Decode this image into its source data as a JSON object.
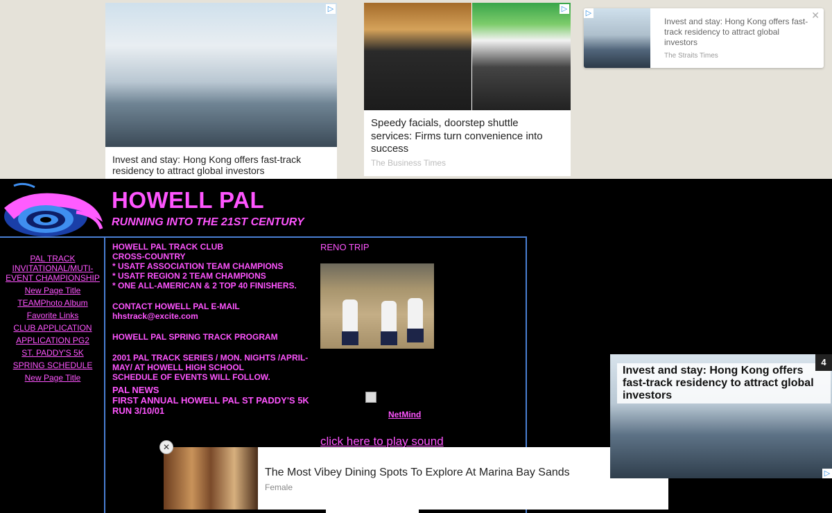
{
  "top_ads": {
    "ad1": {
      "caption": "Invest and stay: Hong Kong offers fast-track residency to attract global investors"
    },
    "ad2": {
      "caption": "Speedy facials, doorstep shuttle services: Firms turn convenience into success",
      "source": "The Business Times"
    },
    "ad3": {
      "caption": "Invest and stay: Hong Kong offers fast-track residency to attract global investors",
      "source": "The Straits Times",
      "close": "✕"
    }
  },
  "header": {
    "title": "HOWELL PAL",
    "subtitle": "RUNNING INTO THE 21ST CENTURY"
  },
  "nav": [
    "PAL TRACK INVITATIONAL/MUTI-EVENT CHAMPIONSHIP",
    "New Page Title",
    "TEAMPhoto Album",
    "Favorite Links",
    "CLUB APPLICATION",
    "APPLICATION PG2",
    "ST. PADDY'S 5K",
    "SPRING SCHEDULE",
    "New Page Title"
  ],
  "content": {
    "club": [
      "HOWELL PAL TRACK CLUB",
      "CROSS-COUNTRY",
      "* USATF ASSOCIATION TEAM CHAMPIONS",
      "* USATF REGION 2 TEAM CHAMPIONS",
      "* ONE ALL-AMERICAN & 2 TOP 40 FINISHERS."
    ],
    "contact": [
      "CONTACT HOWELL PAL E-MAIL",
      "hhstrack@excite.com"
    ],
    "spring": "HOWELL PAL SPRING TRACK PROGRAM",
    "series": [
      "2001 PAL TRACK SERIES / MON. NIGHTS /APRIL-MAY/ AT HOWELL HIGH SCHOOL",
      "SCHEDULE OF EVENTS WILL FOLLOW."
    ],
    "news": [
      "PAL NEWS",
      "FIRST ANNUAL HOWELL PAL ST PADDY'S 5K RUN 3/10/01"
    ],
    "reno": "RENO TRIP",
    "netmind": "NetMind",
    "sound": "click here to play sound"
  },
  "bottom_ad": {
    "caption": "The Most Vibey Dining Spots To Explore At Marina Bay Sands",
    "source": "Female",
    "close": "✕"
  },
  "side_ad": {
    "caption": "Invest and stay: Hong Kong offers fast-track residency to attract global investors",
    "count": "4"
  },
  "colors": {
    "accent": "#ff55ff",
    "frame": "#4a7fd4",
    "background": "#000000"
  }
}
